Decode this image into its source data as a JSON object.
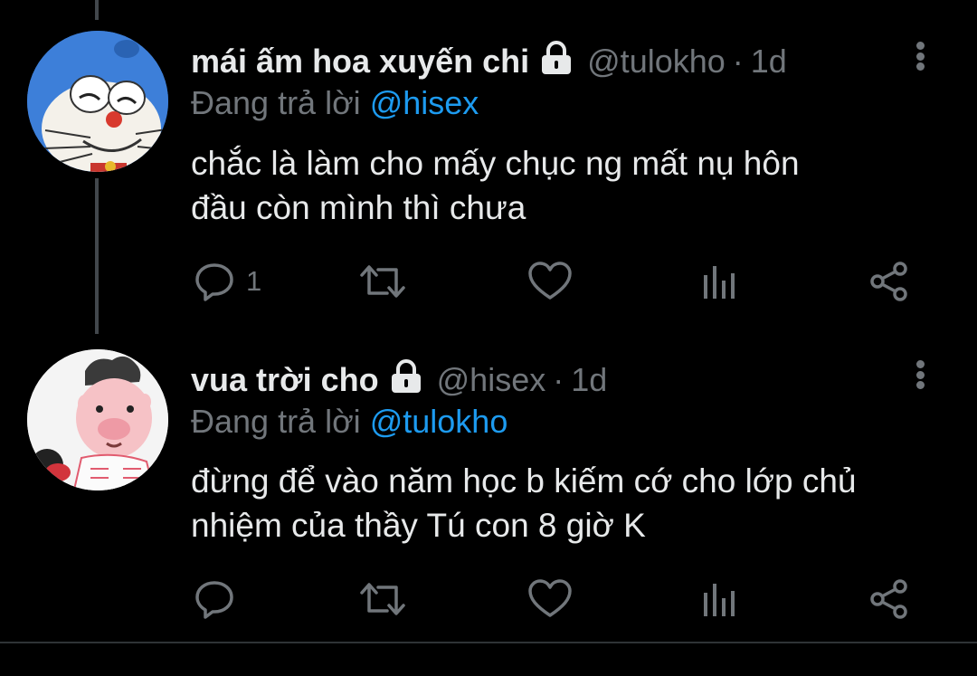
{
  "colors": {
    "background": "#000000",
    "text": "#e7e9ea",
    "secondary": "#71767b",
    "mention": "#1d9bf0",
    "thread_line": "#42474c"
  },
  "tweets": [
    {
      "display_name": "mái ấm hoa xuyến chi",
      "handle": "@tulokho",
      "separator": "·",
      "time": "1d",
      "reply_prefix": "Đang trả lời",
      "reply_to": "@hisex",
      "text_lines": [
        "chắc là làm cho mấy chục ng mất nụ hôn",
        "đầu còn mình thì chưa"
      ],
      "reply_count": "1",
      "avatar_icon": "doraemon-avatar",
      "locked": true
    },
    {
      "display_name": "vua trời cho",
      "handle": "@hisex",
      "separator": "·",
      "time": "1d",
      "reply_prefix": "Đang trả lời",
      "reply_to": "@tulokho",
      "text_lines": [
        "đừng để vào năm học b kiếm cớ cho lớp chủ",
        "nhiệm của thầy Tú con 8 giờ K"
      ],
      "reply_count": "",
      "avatar_icon": "pig-character-avatar",
      "locked": true
    }
  ],
  "icons": [
    "lock-icon",
    "more-options-icon",
    "reply-icon",
    "retweet-icon",
    "like-icon",
    "analytics-icon",
    "share-icon"
  ]
}
